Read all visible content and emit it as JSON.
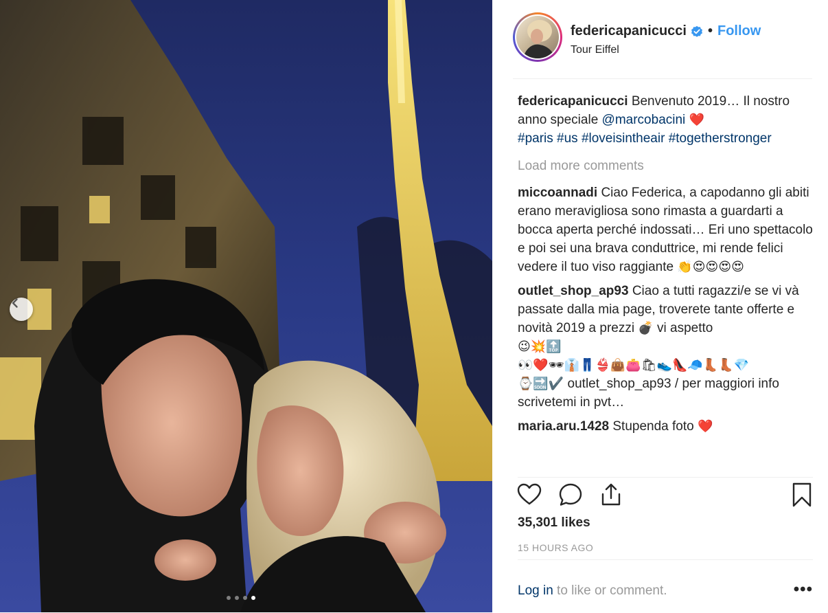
{
  "post": {
    "username": "federicapanicucci",
    "follow_label": "Follow",
    "separator": "•",
    "location": "Tour Eiffel",
    "caption": {
      "username": "federicapanicucci",
      "text_1": "Benvenuto 2019… Il nostro anno speciale",
      "mention": "@marcobacini",
      "heart": "❤️",
      "hashtags": [
        "#paris",
        "#us",
        "#loveisintheair",
        "#togetherstronger"
      ]
    },
    "load_more_label": "Load more comments",
    "comments": [
      {
        "username": "miccoannadi",
        "text": "Ciao Federica, a capodanno gli abiti erano meravigliosa sono rimasta a guardarti a bocca aperta perché indossati… Eri uno spettacolo e poi sei una brava conduttrice, mi rende felici vedere il tuo viso raggiante",
        "emojis": "👏😍😍😍😍"
      },
      {
        "username": "outlet_shop_ap93",
        "text": "Ciao a tutti ragazzi/e se vi và passate dalla mia page, troverete tante offerte e novità 2019 a prezzi",
        "emoji_1": "💣",
        "text_2": "vi aspetto",
        "emoji_line_1": "😉💥🔝",
        "emoji_line_2": "👀❤️🕶👔👖👙👜👛🛍👟👠🧢👢👢💎",
        "emoji_line_3": "⌚🔜✔️",
        "text_3": "outlet_shop_ap93 / per maggiori info scrivetemi in pvt…"
      },
      {
        "username": "maria.aru.1428",
        "text": "Stupenda foto",
        "emojis": "❤️"
      }
    ],
    "likes": "35,301 likes",
    "time_ago": "15 HOURS AGO",
    "login_link": "Log in",
    "login_rest": " to like or comment.",
    "more_label": "•••",
    "carousel": {
      "count": 4,
      "active_index": 3
    }
  },
  "icons": {
    "heart": "heart-icon",
    "comment": "comment-icon",
    "share": "share-icon",
    "save": "bookmark-icon",
    "verified": "verified-badge-icon",
    "prev": "chevron-left-icon"
  },
  "colors": {
    "link_blue": "#3897f0",
    "hashtag_blue": "#003569",
    "muted": "#999999",
    "text": "#262626"
  }
}
